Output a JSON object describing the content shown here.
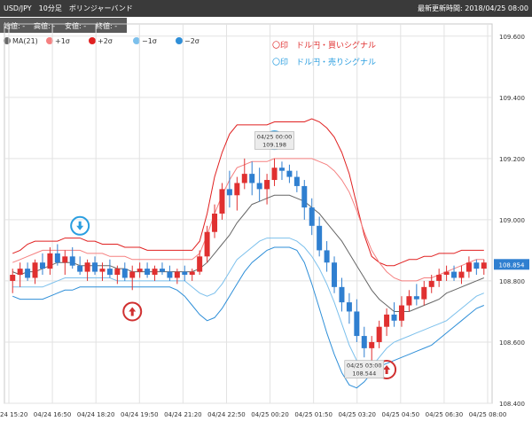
{
  "header": {
    "title": "USD/JPY　10分足　ボリンジャーバンド",
    "updated": "最新更新時間: 2018/04/25 08:00"
  },
  "ohlc": {
    "open": "始値: -",
    "high": "高値: -",
    "low": "安値: -",
    "close": "終値: -"
  },
  "legend": {
    "items": [
      {
        "label": "MA(21)",
        "color": "#666666"
      },
      {
        "label": "+1σ",
        "color": "#f58080"
      },
      {
        "label": "+2σ",
        "color": "#e02020"
      },
      {
        "label": "−1σ",
        "color": "#7cc0ec"
      },
      {
        "label": "−2σ",
        "color": "#2f8fd8"
      }
    ],
    "buy_signal": "〇印　ドル円・買いシグナル",
    "sell_signal": "〇印　ドル円・売りシグナル"
  },
  "colors": {
    "up": "#e03030",
    "down": "#2f7fd0",
    "ma": "#666666",
    "upper1": "#f58080",
    "upper2": "#e02020",
    "lower1": "#7cc0ec",
    "lower2": "#2f8fd8",
    "buy_marker": "#d03030",
    "sell_marker": "#2a9ee0"
  },
  "chart_data": {
    "type": "candlestick",
    "ylim": [
      108.4,
      109.64
    ],
    "y_ticks": [
      "109.600",
      "109.400",
      "109.200",
      "109.000",
      "108.800",
      "108.600",
      "108.400"
    ],
    "x_ticks": [
      "04/24 15:20",
      "04/24 16:50",
      "04/24 18:20",
      "04/24 19:50",
      "04/24 21:20",
      "04/24 22:50",
      "04/25 00:20",
      "04/25 01:50",
      "04/25 03:20",
      "04/25 04:50",
      "04/25 06:30",
      "04/25 08:00"
    ],
    "last_price": "108.854",
    "annotations": [
      {
        "time": "04/25 00:00",
        "value": "109.198"
      },
      {
        "time": "04/25 03:00",
        "value": "108.544"
      }
    ],
    "candles": [
      [
        108.8,
        108.84,
        108.76,
        108.82
      ],
      [
        108.82,
        108.86,
        108.78,
        108.84
      ],
      [
        108.84,
        108.86,
        108.8,
        108.81
      ],
      [
        108.81,
        108.87,
        108.79,
        108.86
      ],
      [
        108.86,
        108.89,
        108.82,
        108.84
      ],
      [
        108.84,
        108.91,
        108.82,
        108.89
      ],
      [
        108.89,
        108.92,
        108.85,
        108.86
      ],
      [
        108.86,
        108.9,
        108.82,
        108.88
      ],
      [
        108.88,
        108.91,
        108.84,
        108.85
      ],
      [
        108.85,
        108.88,
        108.82,
        108.83
      ],
      [
        108.83,
        108.87,
        108.8,
        108.86
      ],
      [
        108.86,
        108.88,
        108.82,
        108.83
      ],
      [
        108.83,
        108.86,
        108.8,
        108.84
      ],
      [
        108.84,
        108.87,
        108.81,
        108.82
      ],
      [
        108.82,
        108.85,
        108.79,
        108.84
      ],
      [
        108.84,
        108.86,
        108.8,
        108.81
      ],
      [
        108.81,
        108.85,
        108.77,
        108.83
      ],
      [
        108.83,
        108.86,
        108.81,
        108.84
      ],
      [
        108.84,
        108.86,
        108.81,
        108.82
      ],
      [
        108.82,
        108.85,
        108.8,
        108.84
      ],
      [
        108.84,
        108.86,
        108.82,
        108.83
      ],
      [
        108.83,
        108.85,
        108.8,
        108.81
      ],
      [
        108.81,
        108.84,
        108.79,
        108.83
      ],
      [
        108.83,
        108.85,
        108.8,
        108.82
      ],
      [
        108.82,
        108.84,
        108.8,
        108.83
      ],
      [
        108.83,
        108.9,
        108.82,
        108.88
      ],
      [
        108.88,
        108.98,
        108.86,
        108.96
      ],
      [
        108.96,
        109.05,
        108.94,
        109.02
      ],
      [
        109.02,
        109.12,
        109.0,
        109.1
      ],
      [
        109.1,
        109.16,
        109.04,
        109.08
      ],
      [
        109.08,
        109.14,
        109.03,
        109.12
      ],
      [
        109.12,
        109.2,
        109.1,
        109.15
      ],
      [
        109.15,
        109.19,
        109.08,
        109.12
      ],
      [
        109.12,
        109.17,
        109.06,
        109.1
      ],
      [
        109.1,
        109.15,
        109.05,
        109.13
      ],
      [
        109.13,
        109.2,
        109.11,
        109.17
      ],
      [
        109.17,
        109.19,
        109.13,
        109.16
      ],
      [
        109.16,
        109.18,
        109.12,
        109.14
      ],
      [
        109.14,
        109.16,
        109.09,
        109.11
      ],
      [
        109.11,
        109.13,
        109.0,
        109.04
      ],
      [
        109.04,
        109.07,
        108.95,
        108.98
      ],
      [
        108.98,
        109.01,
        108.88,
        108.9
      ],
      [
        108.9,
        108.93,
        108.83,
        108.86
      ],
      [
        108.86,
        108.88,
        108.76,
        108.78
      ],
      [
        108.78,
        108.81,
        108.7,
        108.73
      ],
      [
        108.73,
        108.76,
        108.66,
        108.7
      ],
      [
        108.7,
        108.74,
        108.6,
        108.62
      ],
      [
        108.62,
        108.65,
        108.55,
        108.58
      ],
      [
        108.58,
        108.62,
        108.54,
        108.6
      ],
      [
        108.6,
        108.67,
        108.58,
        108.65
      ],
      [
        108.65,
        108.71,
        108.62,
        108.69
      ],
      [
        108.69,
        108.73,
        108.65,
        108.67
      ],
      [
        108.67,
        108.75,
        108.65,
        108.72
      ],
      [
        108.72,
        108.77,
        108.7,
        108.75
      ],
      [
        108.75,
        108.79,
        108.72,
        108.74
      ],
      [
        108.74,
        108.8,
        108.72,
        108.78
      ],
      [
        108.78,
        108.82,
        108.76,
        108.8
      ],
      [
        108.8,
        108.84,
        108.78,
        108.82
      ],
      [
        108.82,
        108.85,
        108.8,
        108.83
      ],
      [
        108.83,
        108.85,
        108.8,
        108.81
      ],
      [
        108.81,
        108.85,
        108.79,
        108.83
      ],
      [
        108.83,
        108.88,
        108.81,
        108.86
      ],
      [
        108.86,
        108.87,
        108.82,
        108.84
      ],
      [
        108.84,
        108.87,
        108.82,
        108.86
      ]
    ],
    "series": {
      "ma": [
        108.83,
        108.82,
        108.83,
        108.83,
        108.84,
        108.85,
        108.86,
        108.86,
        108.86,
        108.85,
        108.85,
        108.85,
        108.85,
        108.85,
        108.84,
        108.84,
        108.83,
        108.83,
        108.83,
        108.83,
        108.83,
        108.83,
        108.83,
        108.83,
        108.83,
        108.84,
        108.86,
        108.89,
        108.92,
        108.95,
        108.99,
        109.02,
        109.05,
        109.06,
        109.07,
        109.08,
        109.08,
        109.08,
        109.07,
        109.06,
        109.04,
        109.02,
        108.99,
        108.96,
        108.93,
        108.89,
        108.85,
        108.81,
        108.77,
        108.74,
        108.72,
        108.7,
        108.7,
        108.7,
        108.71,
        108.72,
        108.73,
        108.74,
        108.76,
        108.77,
        108.78,
        108.79,
        108.8,
        108.81
      ],
      "upper1": [
        108.86,
        108.87,
        108.88,
        108.89,
        108.9,
        108.9,
        108.9,
        108.9,
        108.9,
        108.9,
        108.89,
        108.89,
        108.89,
        108.88,
        108.88,
        108.88,
        108.87,
        108.87,
        108.87,
        108.87,
        108.87,
        108.87,
        108.87,
        108.87,
        108.87,
        108.89,
        108.95,
        109.02,
        109.08,
        109.13,
        109.17,
        109.18,
        109.19,
        109.19,
        109.19,
        109.2,
        109.2,
        109.2,
        109.2,
        109.2,
        109.2,
        109.19,
        109.18,
        109.16,
        109.13,
        109.09,
        109.03,
        108.96,
        108.9,
        108.86,
        108.83,
        108.81,
        108.8,
        108.8,
        108.8,
        108.81,
        108.81,
        108.82,
        108.83,
        108.84,
        108.85,
        108.86,
        108.87,
        108.87
      ],
      "upper2": [
        108.89,
        108.9,
        108.92,
        108.93,
        108.93,
        108.93,
        108.93,
        108.94,
        108.94,
        108.94,
        108.93,
        108.93,
        108.92,
        108.92,
        108.92,
        108.91,
        108.91,
        108.91,
        108.9,
        108.9,
        108.9,
        108.9,
        108.9,
        108.9,
        108.9,
        108.93,
        109.02,
        109.14,
        109.22,
        109.28,
        109.31,
        109.31,
        109.31,
        109.31,
        109.31,
        109.32,
        109.32,
        109.32,
        109.32,
        109.32,
        109.33,
        109.32,
        109.3,
        109.27,
        109.22,
        109.15,
        109.05,
        108.95,
        108.88,
        108.86,
        108.85,
        108.85,
        108.86,
        108.87,
        108.87,
        108.88,
        108.88,
        108.89,
        108.89,
        108.89,
        108.9,
        108.9,
        108.9,
        108.9
      ],
      "lower1": [
        108.78,
        108.78,
        108.78,
        108.78,
        108.78,
        108.79,
        108.8,
        108.81,
        108.81,
        108.81,
        108.81,
        108.81,
        108.81,
        108.81,
        108.8,
        108.8,
        108.8,
        108.8,
        108.8,
        108.8,
        108.8,
        108.8,
        108.8,
        108.8,
        108.78,
        108.76,
        108.75,
        108.76,
        108.79,
        108.83,
        108.87,
        108.89,
        108.91,
        108.93,
        108.94,
        108.94,
        108.94,
        108.94,
        108.93,
        108.91,
        108.88,
        108.84,
        108.79,
        108.73,
        108.66,
        108.59,
        108.54,
        108.51,
        108.52,
        108.55,
        108.58,
        108.6,
        108.61,
        108.62,
        108.63,
        108.64,
        108.65,
        108.66,
        108.67,
        108.69,
        108.71,
        108.73,
        108.75,
        108.76
      ],
      "lower2": [
        108.75,
        108.74,
        108.74,
        108.74,
        108.74,
        108.75,
        108.76,
        108.77,
        108.77,
        108.78,
        108.78,
        108.78,
        108.78,
        108.78,
        108.78,
        108.78,
        108.78,
        108.78,
        108.78,
        108.78,
        108.78,
        108.78,
        108.77,
        108.75,
        108.72,
        108.69,
        108.67,
        108.68,
        108.71,
        108.75,
        108.79,
        108.83,
        108.86,
        108.88,
        108.9,
        108.91,
        108.91,
        108.91,
        108.9,
        108.86,
        108.79,
        108.71,
        108.63,
        108.56,
        108.5,
        108.46,
        108.45,
        108.47,
        108.5,
        108.52,
        108.53,
        108.54,
        108.55,
        108.56,
        108.57,
        108.58,
        108.59,
        108.61,
        108.63,
        108.65,
        108.67,
        108.69,
        108.71,
        108.72
      ]
    }
  }
}
